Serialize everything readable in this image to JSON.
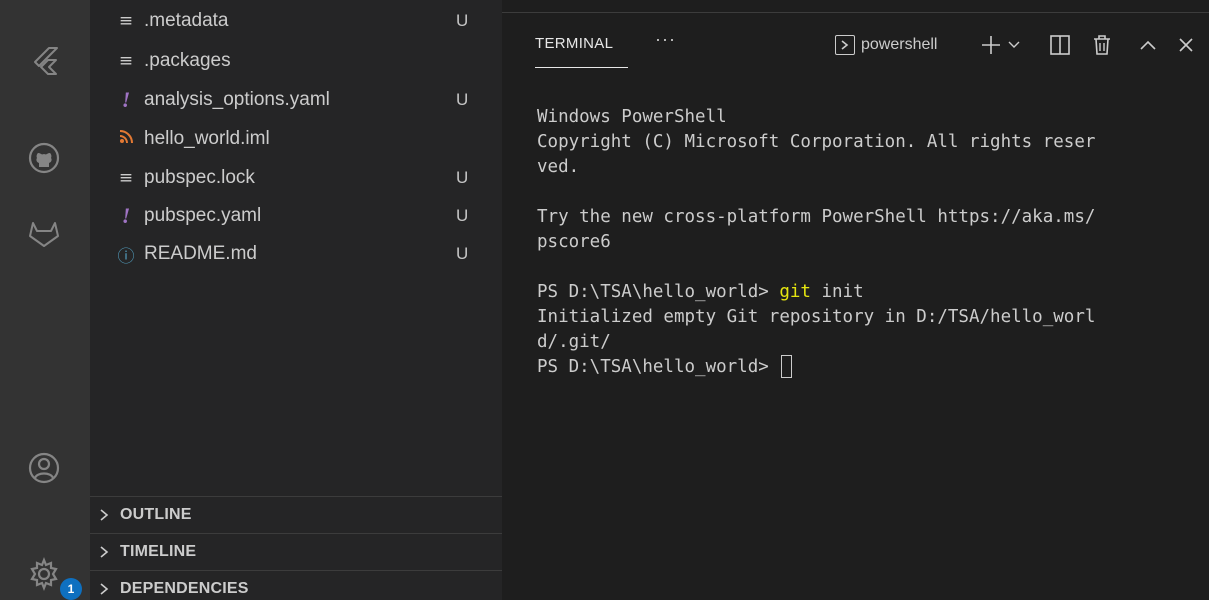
{
  "explorer": {
    "files": [
      {
        "icon": "lines-icon",
        "glyph": "≡",
        "name": ".metadata",
        "status": "U"
      },
      {
        "icon": "lines-icon",
        "glyph": "≡",
        "name": ".packages",
        "status": ""
      },
      {
        "icon": "yaml-icon",
        "glyph": "!",
        "name": "analysis_options.yaml",
        "status": "U"
      },
      {
        "icon": "rss-icon",
        "glyph": "◣",
        "name": "hello_world.iml",
        "status": ""
      },
      {
        "icon": "lines-icon",
        "glyph": "≡",
        "name": "pubspec.lock",
        "status": "U"
      },
      {
        "icon": "yaml-icon",
        "glyph": "!",
        "name": "pubspec.yaml",
        "status": "U"
      },
      {
        "icon": "info-icon",
        "glyph": "ⓘ",
        "name": "README.md",
        "status": "U"
      }
    ],
    "sections": [
      {
        "chevron": "›",
        "label": "OUTLINE"
      },
      {
        "chevron": "›",
        "label": "TIMELINE"
      },
      {
        "chevron": "›",
        "label": "DEPENDENCIES"
      }
    ]
  },
  "activity_bar": {
    "settings_badge": "1"
  },
  "panel": {
    "tab_label": "TERMINAL",
    "more_label": "···",
    "shell_label": "powershell"
  },
  "terminal": {
    "lines": {
      "l1": "Windows PowerShell",
      "l2": "Copyright (C) Microsoft Corporation. All rights reser",
      "l3": "ved.",
      "l4": "Try the new cross-platform PowerShell https://aka.ms/",
      "l5": "pscore6",
      "prompt1": "PS D:\\TSA\\hello_world> ",
      "cmd_git": "git",
      "cmd_rest": " init",
      "l7": "Initialized empty Git repository in D:/TSA/hello_worl",
      "l8": "d/.git/",
      "prompt2": "PS D:\\TSA\\hello_world> "
    }
  },
  "colors": {
    "activity_bar": "#333333",
    "sidebar": "#252526",
    "panel": "#1e1e1e",
    "git_keyword": "#e5e510",
    "badge": "#0e70c0"
  }
}
